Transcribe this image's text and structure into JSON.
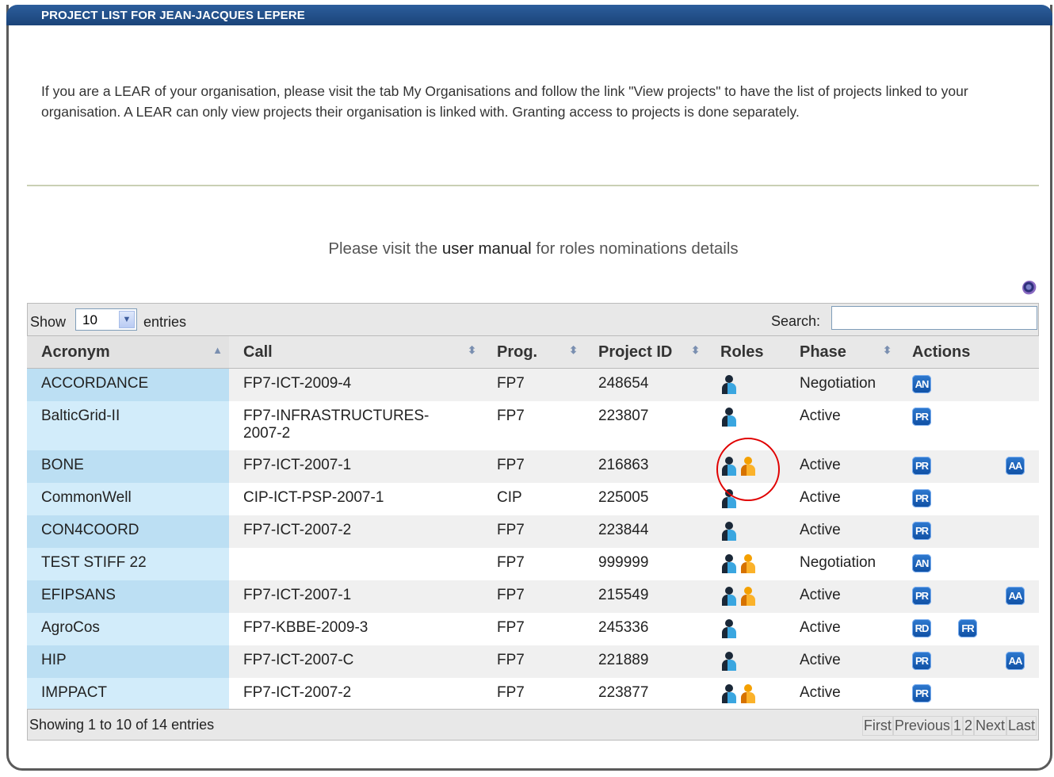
{
  "header": {
    "title": "PROJECT LIST FOR JEAN-JACQUES LEPERE"
  },
  "info_text": "If you are a LEAR of your organisation, please visit the tab My Organisations and follow the link \"View projects\" to have the list of projects linked to your organisation. A LEAR can only view projects their organisation is linked with. Granting access to projects is done separately.",
  "manual": {
    "before": "Please visit the ",
    "link": "user manual",
    "after": " for roles nominations details"
  },
  "toolbar": {
    "show": "Show",
    "page_size": "10",
    "entries": "entries",
    "search_label": "Search:",
    "search_value": ""
  },
  "columns": [
    "Acronym",
    "Call",
    "Prog.",
    "Project ID",
    "Roles",
    "Phase",
    "Actions"
  ],
  "rows": [
    {
      "acronym": "ACCORDANCE",
      "call": "FP7-ICT-2009-4",
      "prog": "FP7",
      "id": "248654",
      "roles": [
        "blue"
      ],
      "phase": "Negotiation",
      "a1": "AN",
      "a2": "",
      "a3": ""
    },
    {
      "acronym": "BalticGrid-II",
      "call": "FP7-INFRASTRUCTURES-2007-2",
      "prog": "FP7",
      "id": "223807",
      "roles": [
        "blue"
      ],
      "phase": "Active",
      "a1": "PR",
      "a2": "",
      "a3": ""
    },
    {
      "acronym": "BONE",
      "call": "FP7-ICT-2007-1",
      "prog": "FP7",
      "id": "216863",
      "roles": [
        "blue",
        "orange"
      ],
      "phase": "Active",
      "a1": "PR",
      "a2": "",
      "a3": "AA"
    },
    {
      "acronym": "CommonWell",
      "call": "CIP-ICT-PSP-2007-1",
      "prog": "CIP",
      "id": "225005",
      "roles": [
        "blue"
      ],
      "phase": "Active",
      "a1": "PR",
      "a2": "",
      "a3": ""
    },
    {
      "acronym": "CON4COORD",
      "call": "FP7-ICT-2007-2",
      "prog": "FP7",
      "id": "223844",
      "roles": [
        "blue"
      ],
      "phase": "Active",
      "a1": "PR",
      "a2": "",
      "a3": ""
    },
    {
      "acronym": "TEST STIFF 22",
      "call": "",
      "prog": "FP7",
      "id": "999999",
      "roles": [
        "blue",
        "orange"
      ],
      "phase": "Negotiation",
      "a1": "AN",
      "a2": "",
      "a3": ""
    },
    {
      "acronym": "EFIPSANS",
      "call": "FP7-ICT-2007-1",
      "prog": "FP7",
      "id": "215549",
      "roles": [
        "blue",
        "orange"
      ],
      "phase": "Active",
      "a1": "PR",
      "a2": "",
      "a3": "AA"
    },
    {
      "acronym": "AgroCos",
      "call": "FP7-KBBE-2009-3",
      "prog": "FP7",
      "id": "245336",
      "roles": [
        "blue"
      ],
      "phase": "Active",
      "a1": "RD",
      "a2": "FR",
      "a3": ""
    },
    {
      "acronym": "HIP",
      "call": "FP7-ICT-2007-C",
      "prog": "FP7",
      "id": "221889",
      "roles": [
        "blue"
      ],
      "phase": "Active",
      "a1": "PR",
      "a2": "",
      "a3": "AA"
    },
    {
      "acronym": "IMPPACT",
      "call": "FP7-ICT-2007-2",
      "prog": "FP7",
      "id": "223877",
      "roles": [
        "blue",
        "orange"
      ],
      "phase": "Active",
      "a1": "PR",
      "a2": "",
      "a3": ""
    }
  ],
  "footer": {
    "info": "Showing 1 to 10 of 14 entries",
    "pager": [
      "First",
      "Previous",
      "1",
      "2",
      "Next",
      "Last"
    ]
  }
}
